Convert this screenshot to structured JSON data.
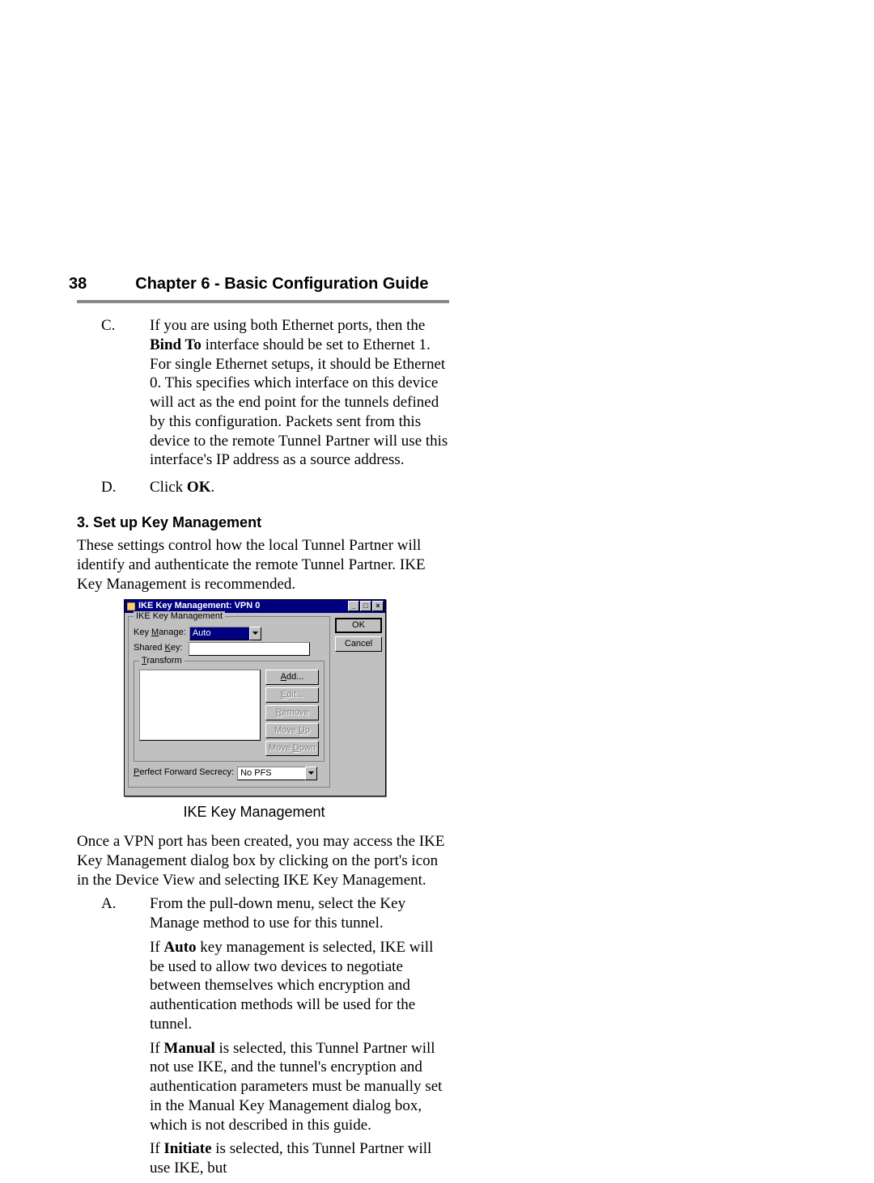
{
  "header": {
    "page_number": "38",
    "chapter_title": "Chapter 6 - Basic Configuration Guide"
  },
  "list1": {
    "C": {
      "marker": "C.",
      "pre": "If you are using both Ethernet ports, then the ",
      "bold1": "Bind To",
      "post": " interface should be set to Ethernet 1. For single Ethernet setups, it should be Ethernet 0. This specifies which interface on this device will act as the end point for the tunnels defined by this configuration. Packets sent from this device to the remote Tunnel Partner will use this interface's IP address as a source address."
    },
    "D": {
      "marker": "D.",
      "pre": "Click ",
      "bold1": "OK",
      "post": "."
    }
  },
  "section3": {
    "heading": "3. Set up Key Management",
    "intro": "These settings control how the local Tunnel Partner will identify and authenticate the remote Tunnel Partner. IKE Key Management is recommended."
  },
  "dialog": {
    "title": "IKE Key Management: VPN 0",
    "group_main": "IKE Key Management",
    "label_key_manage_pre": "Key ",
    "label_key_manage_ul": "M",
    "label_key_manage_post": "anage:",
    "key_manage_value": "Auto",
    "label_shared_key_pre": "Shared ",
    "label_shared_key_ul": "K",
    "label_shared_key_post": "ey:",
    "shared_key_value": "",
    "group_transform_ul": "T",
    "group_transform_post": "ransform",
    "btn_add_ul": "A",
    "btn_add_post": "dd...",
    "btn_edit_ul": "E",
    "btn_edit_post": "dit...",
    "btn_remove_ul": "R",
    "btn_remove_post": "emove",
    "btn_moveup_pre": "Move ",
    "btn_moveup_ul": "U",
    "btn_moveup_post": "p",
    "btn_movedown_pre": "Move ",
    "btn_movedown_ul": "D",
    "btn_movedown_post": "own",
    "label_pfs_ul": "P",
    "label_pfs_post": "erfect Forward Secrecy:",
    "pfs_value": "No PFS",
    "btn_ok": "OK",
    "btn_cancel": "Cancel"
  },
  "caption": "IKE Key Management",
  "para_after_dialog": "Once a VPN port has been created, you may access the IKE Key Management dialog box by clicking on the port's icon in the Device View and selecting IKE Key Management.",
  "list2": {
    "A": {
      "marker": "A.",
      "p1": "From the pull-down menu, select the Key Manage method to use for this tunnel.",
      "p2_pre": "If ",
      "p2_bold": "Auto",
      "p2_post": " key management is selected, IKE will be used to allow two devices to negotiate between themselves which encryption and authentication methods will be used for the tunnel.",
      "p3_pre": "If ",
      "p3_bold": "Manual",
      "p3_post": " is selected, this Tunnel Partner will not use IKE, and the tunnel's encryption and authentication parameters must be manually set in the Manual Key Management dialog box, which is not described in this guide.",
      "p4_pre": "If ",
      "p4_bold": "Initiate",
      "p4_post": " is selected, this Tunnel Partner will use IKE, but"
    }
  }
}
